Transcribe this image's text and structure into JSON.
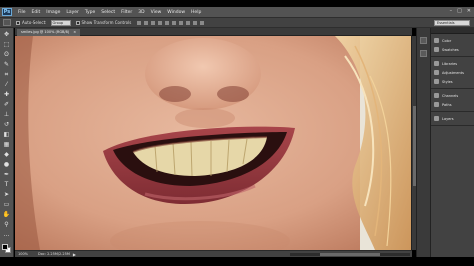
{
  "app": {
    "logo": "Ps"
  },
  "menu": [
    "File",
    "Edit",
    "Image",
    "Layer",
    "Type",
    "Select",
    "Filter",
    "3D",
    "View",
    "Window",
    "Help"
  ],
  "window_controls": [
    "–",
    "□",
    "✕"
  ],
  "options_bar": {
    "auto_select_label": "Auto-Select:",
    "auto_select_value": "Group",
    "transform_label": "Show Transform Controls",
    "workspace": "Essentials"
  },
  "document": {
    "tab_title": "smiles.jpg @ 100% (RGB/8)",
    "tab_close": "×"
  },
  "status": {
    "zoom": "100%",
    "doc": "Doc: 2.25M/2.25M",
    "arrow": "▶"
  },
  "panels": {
    "group1": [
      {
        "icon": "color-icon",
        "label": "Color"
      },
      {
        "icon": "swatches-icon",
        "label": "Swatches"
      }
    ],
    "group2": [
      {
        "icon": "libraries-icon",
        "label": "Libraries"
      },
      {
        "icon": "adjustments-icon",
        "label": "Adjustments"
      },
      {
        "icon": "styles-icon",
        "label": "Styles"
      }
    ],
    "group3": [
      {
        "icon": "channels-icon",
        "label": "Channels"
      },
      {
        "icon": "paths-icon",
        "label": "Paths"
      }
    ],
    "group4": [
      {
        "icon": "layers-icon",
        "label": "Layers"
      }
    ]
  },
  "tools": [
    {
      "name": "move-tool-icon",
      "glyph": "✥"
    },
    {
      "name": "marquee-tool-icon",
      "glyph": "⬚"
    },
    {
      "name": "lasso-tool-icon",
      "glyph": "ʘ"
    },
    {
      "name": "quick-select-tool-icon",
      "glyph": "✎"
    },
    {
      "name": "crop-tool-icon",
      "glyph": "⌗"
    },
    {
      "name": "eyedropper-tool-icon",
      "glyph": "⁄"
    },
    {
      "name": "healing-brush-tool-icon",
      "glyph": "✚"
    },
    {
      "name": "brush-tool-icon",
      "glyph": "✐"
    },
    {
      "name": "clone-stamp-tool-icon",
      "glyph": "⊥"
    },
    {
      "name": "history-brush-tool-icon",
      "glyph": "↺"
    },
    {
      "name": "eraser-tool-icon",
      "glyph": "◧"
    },
    {
      "name": "gradient-tool-icon",
      "glyph": "▦"
    },
    {
      "name": "blur-tool-icon",
      "glyph": "◆"
    },
    {
      "name": "dodge-tool-icon",
      "glyph": "●"
    },
    {
      "name": "pen-tool-icon",
      "glyph": "✒"
    },
    {
      "name": "type-tool-icon",
      "glyph": "T"
    },
    {
      "name": "path-select-tool-icon",
      "glyph": "➤"
    },
    {
      "name": "shape-tool-icon",
      "glyph": "▭"
    },
    {
      "name": "hand-tool-icon",
      "glyph": "✋"
    },
    {
      "name": "zoom-tool-icon",
      "glyph": "⚲"
    },
    {
      "name": "extra-tools-icon",
      "glyph": "…"
    }
  ],
  "colors": {
    "ui_dark": "#424242",
    "ui_mid": "#535353",
    "foreground": "#000000",
    "background": "#ffffff"
  }
}
